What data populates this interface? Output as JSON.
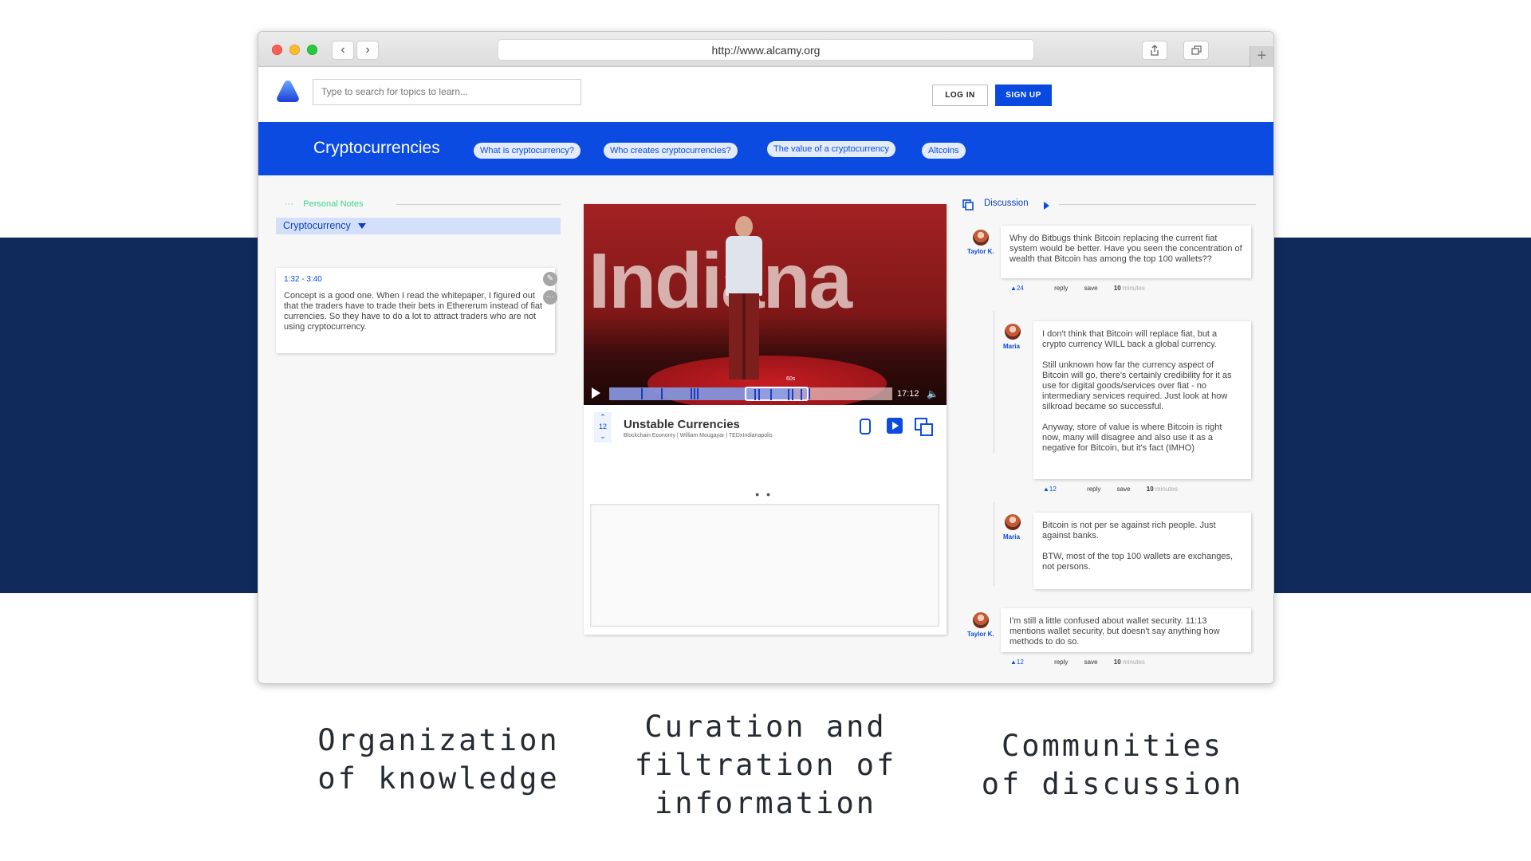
{
  "browser": {
    "url": "http://www.alcamy.org"
  },
  "header": {
    "search_placeholder": "Type to search for topics to learn...",
    "login_label": "LOG IN",
    "signup_label": "SIGN UP"
  },
  "topic": {
    "title": "Cryptocurrencies",
    "chips": [
      "What is cryptocurrency?",
      "Who creates cryptocurrencies?",
      "The value of a cryptocurrency",
      "Altcoins"
    ]
  },
  "notes": {
    "heading": "Personal Notes",
    "dots": "···",
    "selected_topic": "Cryptocurrency",
    "card": {
      "time_range": "1:32 - 3:40",
      "text": "Concept is a good one. When I read the whitepaper, I figured out that the traders have to trade their bets in Ethererum instead of fiat currencies. So they have to do a lot to attract traders who are not using cryptocurrency."
    }
  },
  "video": {
    "stage_word": "Indiana",
    "duration": "17:12",
    "selection_label": "60s",
    "progress_fraction": 0.65,
    "votes": "12",
    "title": "Unstable Currencies",
    "subtitle": "Blockchain Economy | William Mougayar | TEDxIndianapolis",
    "pager": "● ●"
  },
  "discussion": {
    "heading": "Discussion",
    "comments": [
      {
        "author": "Taylor K.",
        "paragraphs": [
          "Why do Bitbugs think Bitcoin replacing the current fiat system would be better. Have you seen the concentration of wealth that Bitcoin has among the top 100 wallets??"
        ],
        "likes": "24",
        "reply": "reply",
        "save": "save",
        "time_value": "10",
        "time_unit": "minutes"
      },
      {
        "author": "Maria",
        "paragraphs": [
          "I don't think that Bitcoin will replace fiat, but a crypto currency WILL back a global currency.",
          "Still unknown how far the currency aspect of Bitcoin will go, there's certainly credibility for it as use for digital goods/services over fiat - no intermediary services required. Just look at how silkroad became so successful.",
          "Anyway, store of value is where Bitcoin is right now, many will disagree and also use it as a negative for Bitcoin, but it's fact (IMHO)"
        ],
        "likes": "12",
        "reply": "reply",
        "save": "save",
        "time_value": "10",
        "time_unit": "minutes"
      },
      {
        "author": "Maria",
        "paragraphs": [
          "Bitcoin is not per se against rich people. Just against banks.",
          "BTW, most of the top 100 wallets are exchanges, not persons."
        ]
      },
      {
        "author": "Taylor K.",
        "paragraphs": [
          "I'm still a little confused about wallet security. 11:13 mentions wallet security, but doesn't say anything how methods to do so."
        ],
        "likes": "12",
        "reply": "reply",
        "save": "save",
        "time_value": "10",
        "time_unit": "minutes"
      }
    ]
  },
  "captions": {
    "left": [
      "Organization",
      "of knowledge"
    ],
    "center": [
      "Curation and",
      "filtration of",
      "information"
    ],
    "right": [
      "Communities",
      "of discussion"
    ]
  },
  "colors": {
    "brand_blue": "#0b4be2",
    "navy_band": "#0f2a5b",
    "notes_green": "#3ed68e"
  }
}
